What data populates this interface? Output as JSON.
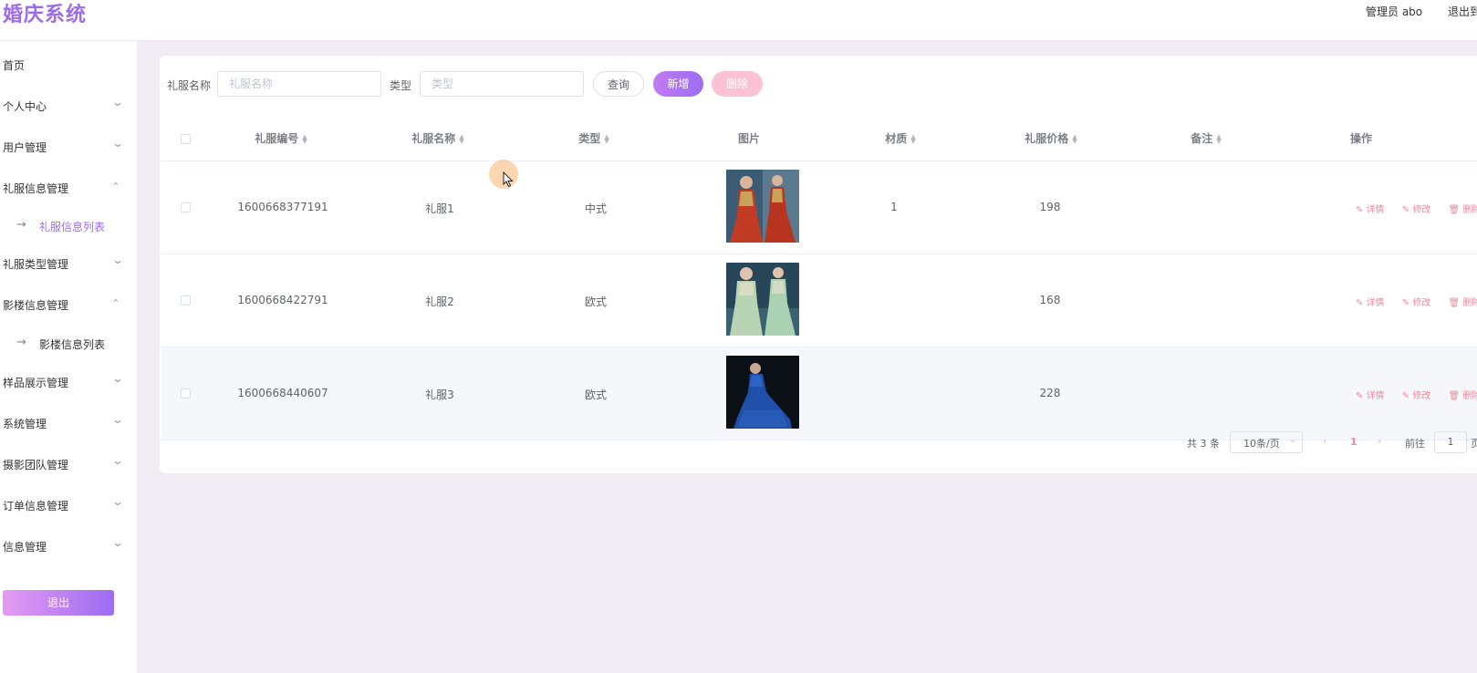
{
  "header": {
    "title": "婚庆系统",
    "user": "管理员 abo",
    "logout": "退出到"
  },
  "sidebar": {
    "items": [
      {
        "label": "首页"
      },
      {
        "label": "个人中心"
      },
      {
        "label": "用户管理"
      },
      {
        "label": "礼服信息管理"
      },
      {
        "label": "礼服信息列表"
      },
      {
        "label": "礼服类型管理"
      },
      {
        "label": "影楼信息管理"
      },
      {
        "label": "影楼信息列表"
      },
      {
        "label": "样品展示管理"
      },
      {
        "label": "系统管理"
      },
      {
        "label": "摄影团队管理"
      },
      {
        "label": "订单信息管理"
      },
      {
        "label": "信息管理"
      }
    ],
    "logout_button": "退出"
  },
  "search": {
    "name_label": "礼服名称",
    "name_placeholder": "礼服名称",
    "type_label": "类型",
    "type_placeholder": "类型",
    "query_button": "查询",
    "add_button": "新增",
    "delete_button": "删除"
  },
  "table": {
    "columns": [
      "礼服编号",
      "礼服名称",
      "类型",
      "图片",
      "材质",
      "礼服价格",
      "备注",
      "操作"
    ],
    "rows": [
      {
        "id": "1600668377191",
        "name": "礼服1",
        "type": "中式",
        "material": "1",
        "price": "198",
        "note": ""
      },
      {
        "id": "1600668422791",
        "name": "礼服2",
        "type": "欧式",
        "material": "",
        "price": "168",
        "note": ""
      },
      {
        "id": "1600668440607",
        "name": "礼服3",
        "type": "欧式",
        "material": "",
        "price": "228",
        "note": ""
      }
    ],
    "actions": {
      "detail": "详情",
      "edit": "修改",
      "delete": "删除"
    }
  },
  "pagination": {
    "total": "共 3 条",
    "page_size": "10条/页",
    "current_page": "1",
    "goto_label": "前往",
    "goto_value": "1",
    "page_suffix": "页"
  },
  "colors": {
    "accent": "#9b6cf0",
    "danger": "#f08a9c",
    "background": "#f1ecf3"
  }
}
